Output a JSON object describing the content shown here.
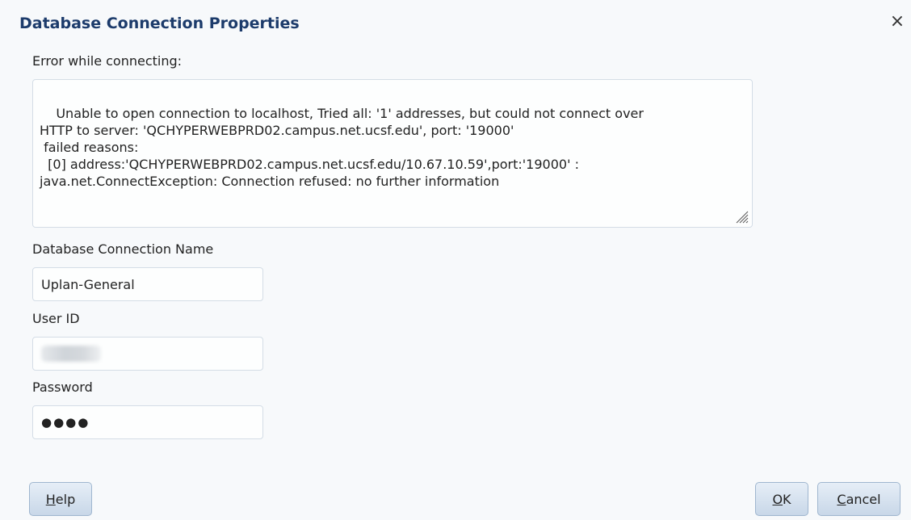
{
  "dialog": {
    "title": "Database Connection Properties",
    "close_glyph": "×"
  },
  "error": {
    "label": "Error while connecting:",
    "message": "Unable to open connection to localhost, Tried all: '1' addresses, but could not connect over\nHTTP to server: 'QCHYPERWEBPRD02.campus.net.ucsf.edu', port: '19000'\n failed reasons:\n  [0] address:'QCHYPERWEBPRD02.campus.net.ucsf.edu/10.67.10.59',port:'19000' :\njava.net.ConnectException: Connection refused: no further information"
  },
  "fields": {
    "connection_name_label": "Database Connection Name",
    "connection_name_value": "Uplan-General",
    "user_id_label": "User ID",
    "password_label": "Password",
    "password_mask": "●●●●"
  },
  "buttons": {
    "help_mnemonic": "H",
    "help_rest": "elp",
    "ok_mnemonic": "O",
    "ok_rest": "K",
    "cancel_mnemonic": "C",
    "cancel_rest": "ancel"
  },
  "icons": {
    "close": "close-icon",
    "resize": "resize-grip-icon"
  },
  "colors": {
    "title": "#1c3b6b",
    "button_border": "#9fb6cf"
  }
}
